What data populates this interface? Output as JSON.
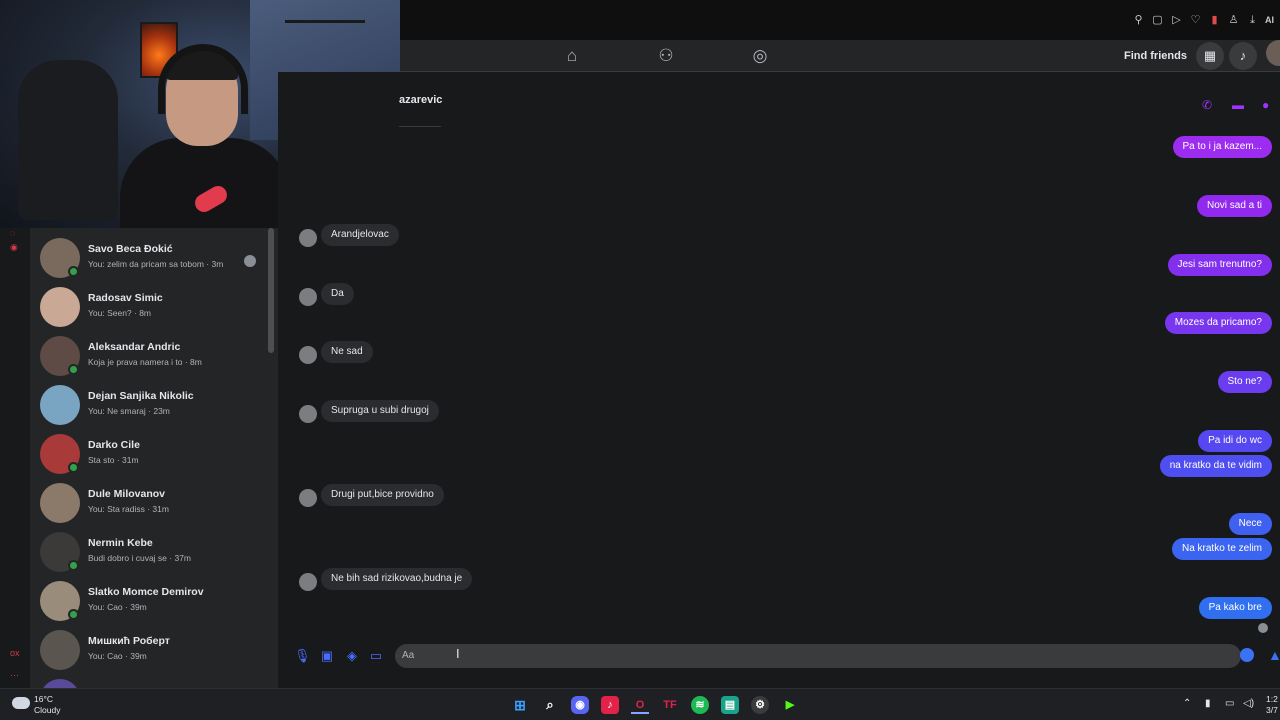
{
  "nav": {
    "find_friends": "Find friends",
    "home_icon": "home-icon",
    "friends_icon": "friends-icon",
    "groups_icon": "groups-icon"
  },
  "conversation": {
    "contact_name": "azarevic",
    "incoming": [
      "Arandjelovac",
      "Da",
      "Ne sad",
      "Supruga u subi drugoj",
      "Drugi put,bice providno",
      "Ne bih sad rizikovao,budna je"
    ],
    "outgoing": [
      "Pa to i ja kazem...",
      "Novi sad a ti",
      "Jesi sam trenutno?",
      "Mozes da pricamo?",
      "Sto ne?",
      "Pa idi do wc",
      "na kratko da te vidim",
      "Nece",
      "Na kratko te zelim",
      "Pa kako bre"
    ],
    "composer_placeholder": "Aa"
  },
  "chat_list": [
    {
      "name": "Savo Beca Đokić",
      "preview": "You: zelim da pricam sa tobom · 3m",
      "online": true
    },
    {
      "name": "Radosav Simic",
      "preview": "You: Seen? · 8m",
      "online": false
    },
    {
      "name": "Aleksandar Andric",
      "preview": "Koja je prava namera i to · 8m",
      "online": true
    },
    {
      "name": "Dejan Sanjika Nikolic",
      "preview": "You: Ne smaraj · 23m",
      "online": false
    },
    {
      "name": "Darko Cile",
      "preview": "Sta sto · 31m",
      "online": true
    },
    {
      "name": "Dule Milovanov",
      "preview": "You: Sta radiss · 31m",
      "online": false
    },
    {
      "name": "Nermin Kebe",
      "preview": "Budi dobro i cuvaj se · 37m",
      "online": true
    },
    {
      "name": "Slatko Momce Demirov",
      "preview": "You: Cao · 39m",
      "online": true
    },
    {
      "name": "Мишкић Роберт",
      "preview": "You: Cao · 39m",
      "online": false
    }
  ],
  "taskbar": {
    "temperature": "16°C",
    "condition": "Cloudy",
    "clock_time": "1:2",
    "clock_date": "3/7"
  },
  "colors": {
    "outgoing_purple": "#9b2cf0",
    "outgoing_blue": "#2f6ff0",
    "accent": "#a033ff"
  }
}
